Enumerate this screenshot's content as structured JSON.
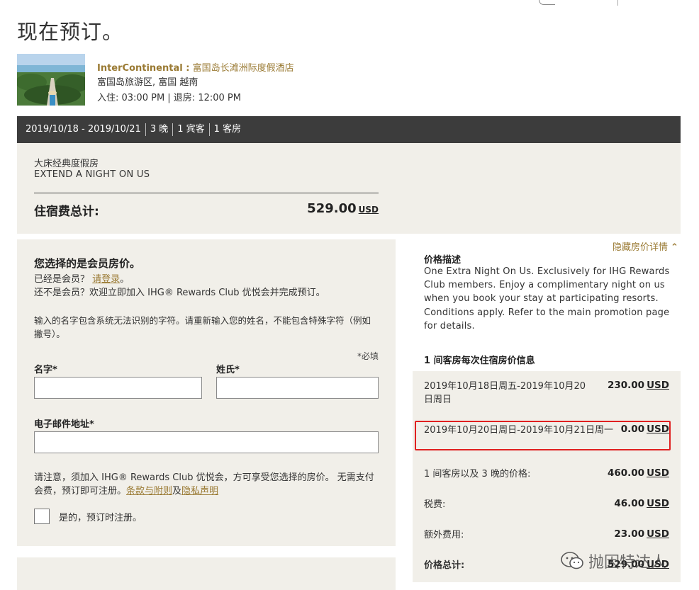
{
  "page": {
    "title": "现在预订。"
  },
  "hotel": {
    "brand": "InterContinental :",
    "name": "富国岛长滩洲际度假酒店",
    "location": "富国岛旅游区, 富国 越南",
    "times": "入住:  03:00 PM | 退房:  12:00 PM"
  },
  "summary": {
    "dates": "2019/10/18 - 2019/10/21",
    "nights": "3 晚",
    "guests": "1 宾客",
    "rooms": "1 客房"
  },
  "room": {
    "name": "大床经典度假房",
    "offer": "EXTEND A NIGHT ON US",
    "total_label": "住宿费总计:",
    "total_amount": "529.00",
    "currency": "USD"
  },
  "member_form": {
    "title": "您选择的是会员房价。",
    "already_member": "已经是会员？",
    "login_link": "请登录",
    "login_after": "。",
    "not_member": "还不是会员？欢迎立即加入 IHG® Rewards Club 优悦会并完成预订。",
    "name_note": "输入的名字包含系统无法识别的字符。请重新输入您的姓名，不能包含特殊字符（例如撇号）。",
    "required": "*必填",
    "first_name_label": "名字*",
    "last_name_label": "姓氏*",
    "email_label": "电子邮件地址*",
    "first_name_value": "",
    "last_name_value": "",
    "email_value": "",
    "join_note_before": "请注意，须加入 IHG® Rewards Club 优悦会，方可享受您选择的房价。 无需支付会费，预订即可注册。",
    "terms_link": "条款与附则",
    "and": "及",
    "privacy_link": "隐私声明",
    "checkbox_label": "是的，预订时注册。"
  },
  "price_panel": {
    "hide_link": "隐藏房价详情",
    "desc_title": "价格描述",
    "desc_text": "One Extra Night On Us. Exclusively for IHG Rewards Club members. Enjoy a complimentary night on us when you book your stay at participating resorts. Conditions apply. Refer to the main promotion page for details.",
    "nightly_title": "1 间客房每次住宿房价信息",
    "rows": [
      {
        "label": "2019年10月18日周五-2019年10月20日周日",
        "amount": "230.00",
        "currency": "USD"
      },
      {
        "label": "2019年10月20日周日-2019年10月21日周一",
        "amount": "0.00",
        "currency": "USD"
      },
      {
        "label": "1 间客房以及 3 晚的价格:",
        "amount": "460.00",
        "currency": "USD"
      },
      {
        "label": "税费:",
        "amount": "46.00",
        "currency": "USD"
      },
      {
        "label": "额外费用:",
        "amount": "23.00",
        "currency": "USD"
      },
      {
        "label": "价格总计:",
        "amount": "529.00",
        "currency": "USD"
      }
    ]
  },
  "watermark": {
    "text": "抛因特达人"
  },
  "colors": {
    "gold": "#9a7a33",
    "dark_bar": "#3c3c3c",
    "panel_bg": "#f1efe9",
    "highlight": "#e02020"
  }
}
